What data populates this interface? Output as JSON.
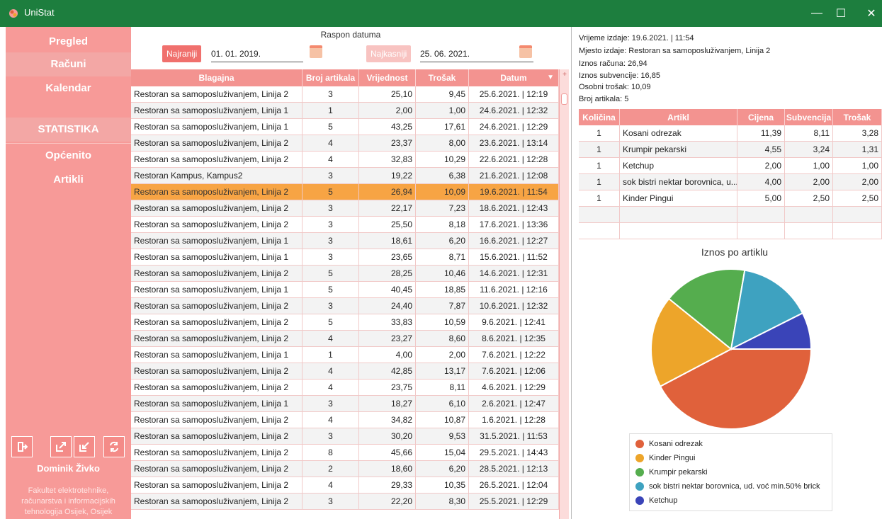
{
  "window": {
    "title": "UniStat",
    "minimize": "—",
    "maximize": "☐",
    "close": "✕"
  },
  "sidebar": {
    "nav": [
      {
        "label": "Pregled"
      },
      {
        "label": "Računi"
      },
      {
        "label": "Kalendar"
      }
    ],
    "stat_header": "STATISTIKA",
    "stat_nav": [
      {
        "label": "Općenito"
      },
      {
        "label": "Artikli"
      }
    ],
    "user_name": "Dominik Živko",
    "user_institution": [
      "Fakultet elektrotehnike,",
      "računarstva i informacijskih",
      "tehnologija Osijek, Osijek"
    ]
  },
  "date_range": {
    "label": "Raspon datuma",
    "earliest_button": "Najraniji",
    "from": "01. 01. 2019.",
    "latest_button": "Najkasniji",
    "to": "25. 06. 2021."
  },
  "receipts": {
    "columns": [
      "Blagajna",
      "Broj artikala",
      "Vrijednost",
      "Trošak",
      "Datum"
    ],
    "sort_indicator": "▼",
    "add_column": "+",
    "rows": [
      [
        "Restoran sa samoposluživanjem, Linija 2",
        "3",
        "25,10",
        "9,45",
        "25.6.2021. | 12:19"
      ],
      [
        "Restoran sa samoposluživanjem, Linija 1",
        "1",
        "2,00",
        "1,00",
        "24.6.2021. | 12:32"
      ],
      [
        "Restoran sa samoposluživanjem, Linija 1",
        "5",
        "43,25",
        "17,61",
        "24.6.2021. | 12:29"
      ],
      [
        "Restoran sa samoposluživanjem, Linija 2",
        "4",
        "23,37",
        "8,00",
        "23.6.2021. | 13:14"
      ],
      [
        "Restoran sa samoposluživanjem, Linija 2",
        "4",
        "32,83",
        "10,29",
        "22.6.2021. | 12:28"
      ],
      [
        "Restoran Kampus, Kampus2",
        "3",
        "19,22",
        "6,38",
        "21.6.2021. | 12:08"
      ],
      [
        "Restoran sa samoposluživanjem, Linija 2",
        "5",
        "26,94",
        "10,09",
        "19.6.2021. | 11:54"
      ],
      [
        "Restoran sa samoposluživanjem, Linija 2",
        "3",
        "22,17",
        "7,23",
        "18.6.2021. | 12:43"
      ],
      [
        "Restoran sa samoposluživanjem, Linija 2",
        "3",
        "25,50",
        "8,18",
        "17.6.2021. | 13:36"
      ],
      [
        "Restoran sa samoposluživanjem, Linija 1",
        "3",
        "18,61",
        "6,20",
        "16.6.2021. | 12:27"
      ],
      [
        "Restoran sa samoposluživanjem, Linija 1",
        "3",
        "23,65",
        "8,71",
        "15.6.2021. | 11:52"
      ],
      [
        "Restoran sa samoposluživanjem, Linija 2",
        "5",
        "28,25",
        "10,46",
        "14.6.2021. | 12:31"
      ],
      [
        "Restoran sa samoposluživanjem, Linija 1",
        "5",
        "40,45",
        "18,85",
        "11.6.2021. | 12:16"
      ],
      [
        "Restoran sa samoposluživanjem, Linija 2",
        "3",
        "24,40",
        "7,87",
        "10.6.2021. | 12:32"
      ],
      [
        "Restoran sa samoposluživanjem, Linija 2",
        "5",
        "33,83",
        "10,59",
        "9.6.2021. | 12:41"
      ],
      [
        "Restoran sa samoposluživanjem, Linija 2",
        "4",
        "23,27",
        "8,60",
        "8.6.2021. | 12:35"
      ],
      [
        "Restoran sa samoposluživanjem, Linija 1",
        "1",
        "4,00",
        "2,00",
        "7.6.2021. | 12:22"
      ],
      [
        "Restoran sa samoposluživanjem, Linija 2",
        "4",
        "42,85",
        "13,17",
        "7.6.2021. | 12:06"
      ],
      [
        "Restoran sa samoposluživanjem, Linija 2",
        "4",
        "23,75",
        "8,11",
        "4.6.2021. | 12:29"
      ],
      [
        "Restoran sa samoposluživanjem, Linija 1",
        "3",
        "18,27",
        "6,10",
        "2.6.2021. | 12:47"
      ],
      [
        "Restoran sa samoposluživanjem, Linija 2",
        "4",
        "34,82",
        "10,87",
        "1.6.2021. | 12:28"
      ],
      [
        "Restoran sa samoposluživanjem, Linija 2",
        "3",
        "30,20",
        "9,53",
        "31.5.2021. | 11:53"
      ],
      [
        "Restoran sa samoposluživanjem, Linija 2",
        "8",
        "45,66",
        "15,04",
        "29.5.2021. | 14:43"
      ],
      [
        "Restoran sa samoposluživanjem, Linija 2",
        "2",
        "18,60",
        "6,20",
        "28.5.2021. | 12:13"
      ],
      [
        "Restoran sa samoposluživanjem, Linija 2",
        "4",
        "29,33",
        "10,35",
        "26.5.2021. | 12:04"
      ],
      [
        "Restoran sa samoposluživanjem, Linija 2",
        "3",
        "22,20",
        "8,30",
        "25.5.2021. | 12:29"
      ]
    ],
    "selected_index": 6
  },
  "details": {
    "lines": [
      "Vrijeme izdaje: 19.6.2021. | 11:54",
      "Mjesto izdaje: Restoran sa samoposluživanjem, Linija 2",
      "Iznos računa: 26,94",
      "Iznos subvencije: 16,85",
      "Osobni trošak: 10,09",
      "Broj artikala: 5"
    ]
  },
  "items": {
    "columns": [
      "Količina",
      "Artikl",
      "Cijena",
      "Subvencija",
      "Trošak"
    ],
    "rows": [
      [
        "1",
        "Kosani odrezak",
        "11,39",
        "8,11",
        "3,28"
      ],
      [
        "1",
        "Krumpir pekarski",
        "4,55",
        "3,24",
        "1,31"
      ],
      [
        "1",
        "Ketchup",
        "2,00",
        "1,00",
        "1,00"
      ],
      [
        "1",
        "sok bistri nektar borovnica, u...",
        "4,00",
        "2,00",
        "2,00"
      ],
      [
        "1",
        "Kinder Pingui",
        "5,00",
        "2,50",
        "2,50"
      ]
    ]
  },
  "colors": {
    "titlebar": "#1d7e3e",
    "sidebar": "#f79a98",
    "accent": "#f39390",
    "selected": "#f7a444"
  },
  "chart_data": {
    "type": "pie",
    "title": "Iznos po artiklu",
    "series": [
      {
        "name": "Kosani odrezak",
        "value": 11.39,
        "color": "#e0613b"
      },
      {
        "name": "Kinder Pingui",
        "value": 5.0,
        "color": "#eda52a"
      },
      {
        "name": "Krumpir pekarski",
        "value": 4.55,
        "color": "#55ad4e"
      },
      {
        "name": "sok bistri nektar borovnica, ud. voć min.50% brick",
        "value": 4.0,
        "color": "#3ea2c0"
      },
      {
        "name": "Ketchup",
        "value": 2.0,
        "color": "#3a44b8"
      }
    ],
    "legend_position": "bottom"
  }
}
